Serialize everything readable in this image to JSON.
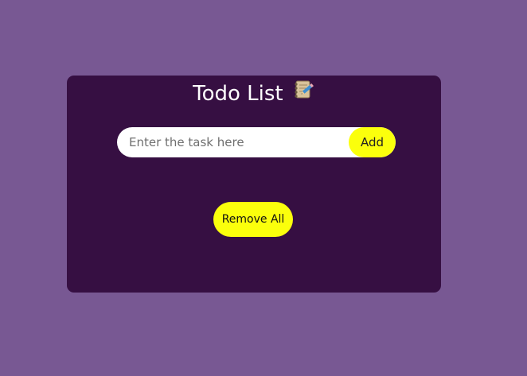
{
  "app": {
    "title": "Todo List",
    "title_icon": "notepad-pencil-icon"
  },
  "form": {
    "placeholder": "Enter the task here",
    "value": "",
    "add_label": "Add"
  },
  "actions": {
    "remove_all_label": "Remove All"
  },
  "colors": {
    "page_background": "#785893",
    "card_background": "#360f42",
    "accent": "#fbff0c",
    "input_background": "#ffffff",
    "title_text": "#ffffff"
  }
}
